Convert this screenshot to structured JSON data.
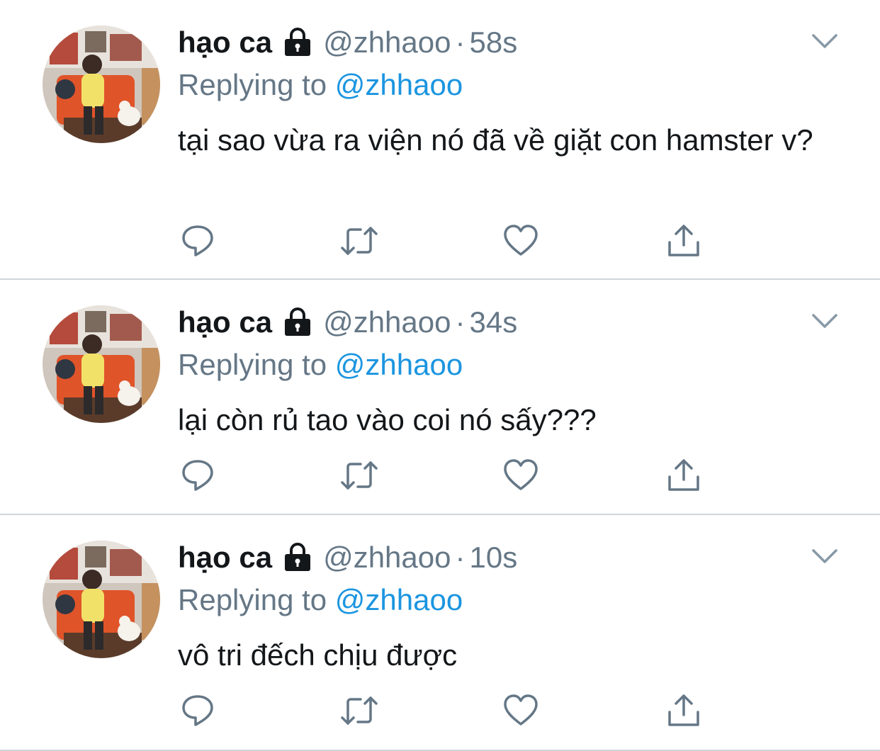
{
  "colors": {
    "text_primary": "#14171a",
    "text_secondary": "#657786",
    "link": "#1b95e0",
    "divider": "#cfd6db"
  },
  "icons": {
    "lock": "lock-icon",
    "caret": "chevron-down-icon",
    "reply": "reply-bubble-icon",
    "retweet": "retweet-icon",
    "like": "heart-icon",
    "share": "share-icon"
  },
  "tweets": [
    {
      "name": "hạo ca",
      "handle": "@zhhaoo",
      "separator": "·",
      "time": "58s",
      "replying_prefix": "Replying to",
      "replying_to": "@zhhaoo",
      "text": "tại sao vừa ra viện nó đã về giặt con hamster v?"
    },
    {
      "name": "hạo ca",
      "handle": "@zhhaoo",
      "separator": "·",
      "time": "34s",
      "replying_prefix": "Replying to",
      "replying_to": "@zhhaoo",
      "text": "lại còn rủ tao vào coi nó sấy???"
    },
    {
      "name": "hạo ca",
      "handle": "@zhhaoo",
      "separator": "·",
      "time": "10s",
      "replying_prefix": "Replying to",
      "replying_to": "@zhhaoo",
      "text": "vô tri đếch chịu được"
    }
  ]
}
